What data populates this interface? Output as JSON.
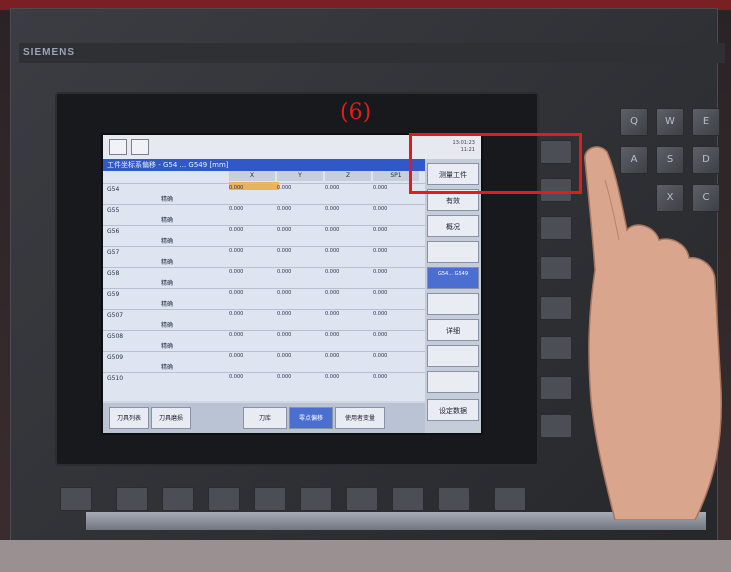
{
  "brand": "SIEMENS",
  "annotation": {
    "label": "(6)",
    "color": "#e31b1b"
  },
  "screen": {
    "window_title": "工件坐标系偏移 - G54 ... G549 [mm]",
    "time": [
      "13:01:23",
      "11:21"
    ],
    "columns": [
      "X",
      "Y",
      "Z",
      "SP1"
    ],
    "rows": [
      {
        "name": "G54",
        "sub": "精确",
        "values": [
          "0.000",
          "0.000",
          "0.000",
          "0.000"
        ]
      },
      {
        "name": "G55",
        "sub": "精确",
        "values": [
          "0.000",
          "0.000",
          "0.000",
          "0.000"
        ]
      },
      {
        "name": "G56",
        "sub": "精确",
        "values": [
          "0.000",
          "0.000",
          "0.000",
          "0.000"
        ]
      },
      {
        "name": "G57",
        "sub": "精确",
        "values": [
          "0.000",
          "0.000",
          "0.000",
          "0.000"
        ]
      },
      {
        "name": "G58",
        "sub": "精确",
        "values": [
          "0.000",
          "0.000",
          "0.000",
          "0.000"
        ]
      },
      {
        "name": "G59",
        "sub": "精确",
        "values": [
          "0.000",
          "0.000",
          "0.000",
          "0.000"
        ]
      },
      {
        "name": "G507",
        "sub": "精确",
        "values": [
          "0.000",
          "0.000",
          "0.000",
          "0.000"
        ]
      },
      {
        "name": "G508",
        "sub": "精确",
        "values": [
          "0.000",
          "0.000",
          "0.000",
          "0.000"
        ]
      },
      {
        "name": "G509",
        "sub": "精确",
        "values": [
          "0.000",
          "0.000",
          "0.000",
          "0.000"
        ]
      },
      {
        "name": "G510",
        "sub": "",
        "values": [
          "0.000",
          "0.000",
          "0.000",
          "0.000"
        ]
      }
    ],
    "right_softkeys": [
      "测量工件",
      "有效",
      "概况",
      "",
      "G54... G549",
      "",
      "详细",
      "",
      "",
      "设定数据"
    ],
    "bottom_softkeys": [
      "刀具列表",
      "刀具磨损",
      "",
      "刀库",
      "零点偏移",
      "使用者变量"
    ]
  },
  "keys": [
    "Q",
    "W",
    "E",
    "A",
    "S",
    "D",
    "X",
    "C"
  ]
}
